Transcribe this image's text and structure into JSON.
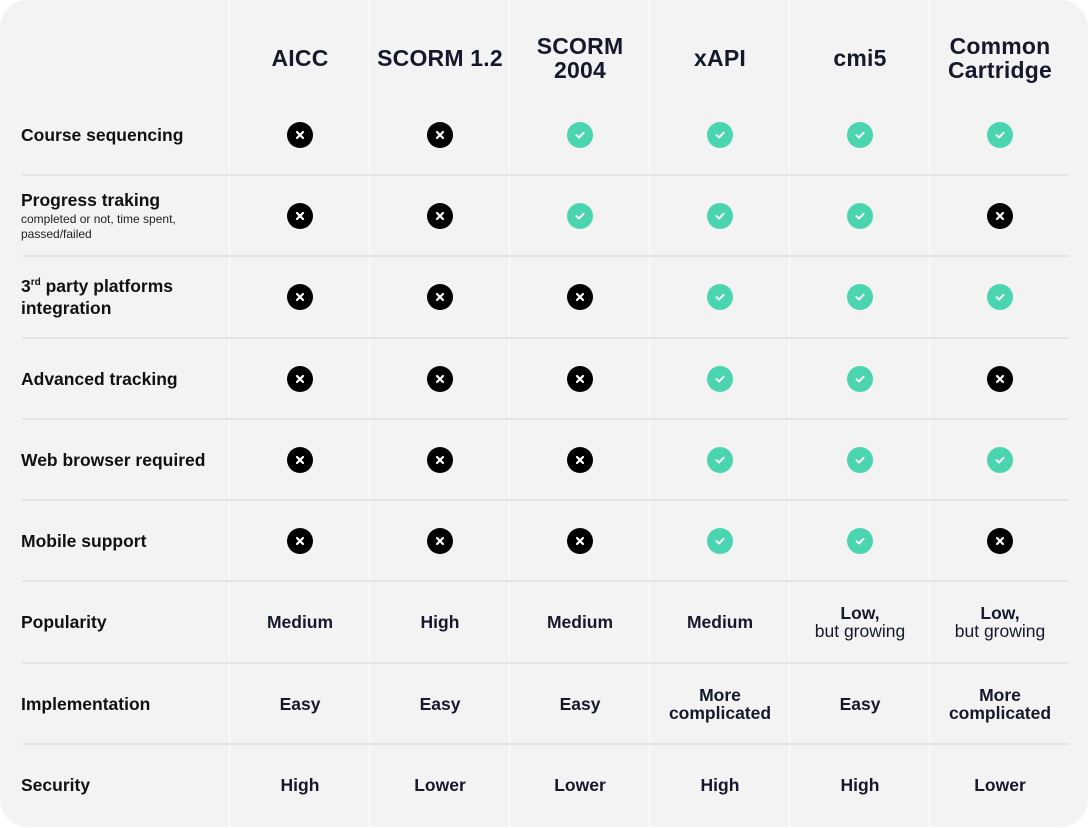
{
  "colors": {
    "background": "#f3f3f3",
    "check": "#4bd4b0",
    "cross": "#000000",
    "text": "#141a2b"
  },
  "columns": [
    {
      "label": "AICC"
    },
    {
      "label": "SCORM 1.2"
    },
    {
      "label": "SCORM\n2004"
    },
    {
      "label": "xAPI"
    },
    {
      "label": "cmi5"
    },
    {
      "label": "Common\nCartridge"
    }
  ],
  "feature_rows": [
    {
      "label": "Course sequencing",
      "values": [
        "no",
        "no",
        "yes",
        "yes",
        "yes",
        "yes"
      ]
    },
    {
      "label": "Progress traking",
      "sublabel": "completed or not, time spent, passed/failed",
      "values": [
        "no",
        "no",
        "yes",
        "yes",
        "yes",
        "no"
      ]
    },
    {
      "label_prefix": "3",
      "label_sup": "rd",
      "label": " party platforms integration",
      "values": [
        "no",
        "no",
        "no",
        "yes",
        "yes",
        "yes"
      ]
    },
    {
      "label": "Advanced tracking",
      "values": [
        "no",
        "no",
        "no",
        "yes",
        "yes",
        "no"
      ]
    },
    {
      "label": "Web browser required",
      "values": [
        "no",
        "no",
        "no",
        "yes",
        "yes",
        "yes"
      ]
    },
    {
      "label": "Mobile support",
      "values": [
        "no",
        "no",
        "no",
        "yes",
        "yes",
        "no"
      ]
    }
  ],
  "text_rows": [
    {
      "label": "Popularity",
      "values": [
        {
          "main": "Medium"
        },
        {
          "main": "High"
        },
        {
          "main": "Medium"
        },
        {
          "main": "Medium"
        },
        {
          "main": "Low,",
          "sub": "but growing"
        },
        {
          "main": "Low,",
          "sub": "but growing"
        }
      ]
    },
    {
      "label": "Implementation",
      "values": [
        {
          "main": "Easy"
        },
        {
          "main": "Easy"
        },
        {
          "main": "Easy"
        },
        {
          "main": "More complicated"
        },
        {
          "main": "Easy"
        },
        {
          "main": "More complicated"
        }
      ]
    },
    {
      "label": "Security",
      "values": [
        {
          "main": "High"
        },
        {
          "main": "Lower"
        },
        {
          "main": "Lower"
        },
        {
          "main": "High"
        },
        {
          "main": "High"
        },
        {
          "main": "Lower"
        }
      ]
    }
  ]
}
